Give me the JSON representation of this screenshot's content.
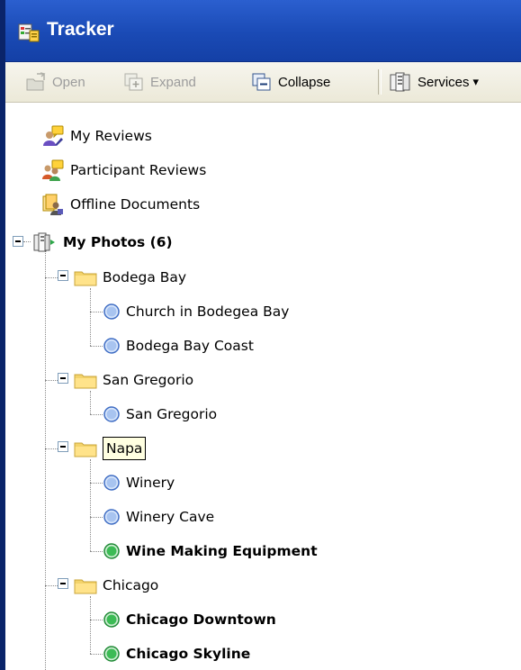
{
  "window": {
    "title": "Tracker"
  },
  "toolbar": {
    "open_label": "Open",
    "expand_label": "Expand",
    "collapse_label": "Collapse",
    "services_label": "Services",
    "services_arrow": "▾"
  },
  "tree": {
    "my_reviews": "My Reviews",
    "participant_reviews": "Participant Reviews",
    "offline_documents": "Offline Documents",
    "my_photos": "My Photos (6)",
    "folders": [
      {
        "name": "Bodega Bay",
        "items": [
          "Church in Bodegea Bay",
          "Bodega Bay Coast"
        ]
      },
      {
        "name": "San Gregorio",
        "items": [
          "San Gregorio"
        ]
      },
      {
        "name": "Napa",
        "items": [
          "Winery",
          "Winery Cave",
          "Wine Making Equipment"
        ]
      },
      {
        "name": "Chicago",
        "items": [
          "Chicago Downtown",
          "Chicago Skyline"
        ]
      }
    ]
  },
  "colors": {
    "title_bar": "#1a4ab5",
    "read_item_bullet": "#5b87d6",
    "unread_item_bullet": "#2ea84a"
  }
}
